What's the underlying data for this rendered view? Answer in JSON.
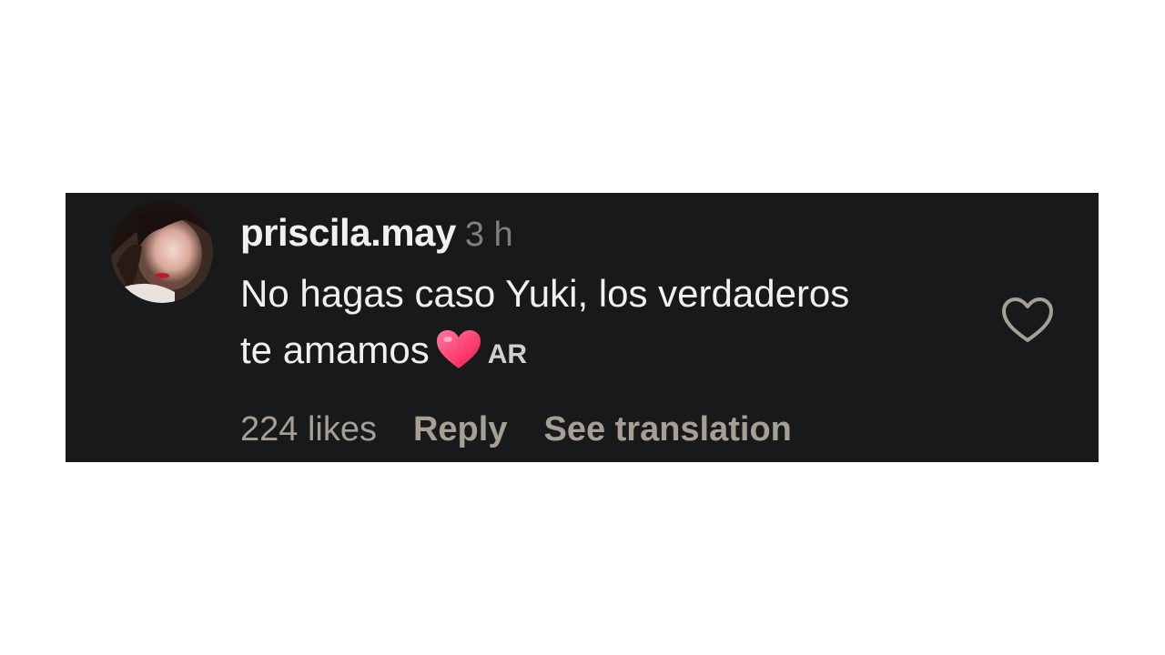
{
  "comment": {
    "username": "priscila.may",
    "time": "3 h",
    "text_line1": "No hagas caso Yuki, los verdaderos",
    "text_line2": "te amamos",
    "emoji": "heart-emoji",
    "flair": "AR",
    "likes": "224 likes",
    "reply_label": "Reply",
    "translate_label": "See translation",
    "like_icon": "heart-outline-icon"
  },
  "colors": {
    "card_background": "#18191b",
    "text_primary": "#f0f0f0",
    "text_secondary": "#a59f94",
    "time_text": "#7f7f7f",
    "heart_emoji": "#ff3d6e"
  }
}
